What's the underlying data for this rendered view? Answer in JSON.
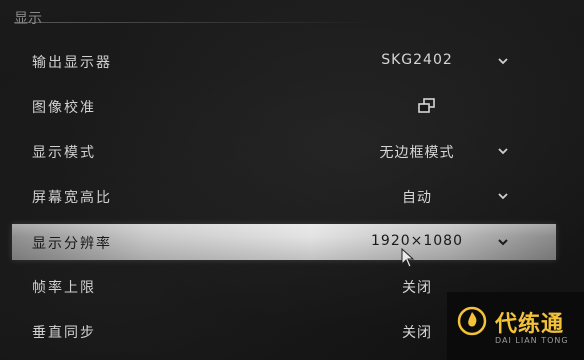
{
  "section": {
    "title": "显示"
  },
  "settings": [
    {
      "label": "输出显示器",
      "value": "SKG2402",
      "control": "dropdown"
    },
    {
      "label": "图像校准",
      "value": "",
      "control": "external-window",
      "icon": "open-window-icon"
    },
    {
      "label": "显示模式",
      "value": "无边框模式",
      "control": "dropdown"
    },
    {
      "label": "屏幕宽高比",
      "value": "自动",
      "control": "dropdown"
    },
    {
      "label": "显示分辨率",
      "value": "1920×1080",
      "control": "dropdown",
      "selected": true
    },
    {
      "label": "帧率上限",
      "value": "关闭",
      "control": "selector"
    },
    {
      "label": "垂直同步",
      "value": "关闭",
      "control": "selector"
    }
  ],
  "watermark": {
    "title": "代练通",
    "subtitle": "DAI LIAN TONG",
    "logo_icon": "flame-icon",
    "accent": "#f3c23a"
  }
}
